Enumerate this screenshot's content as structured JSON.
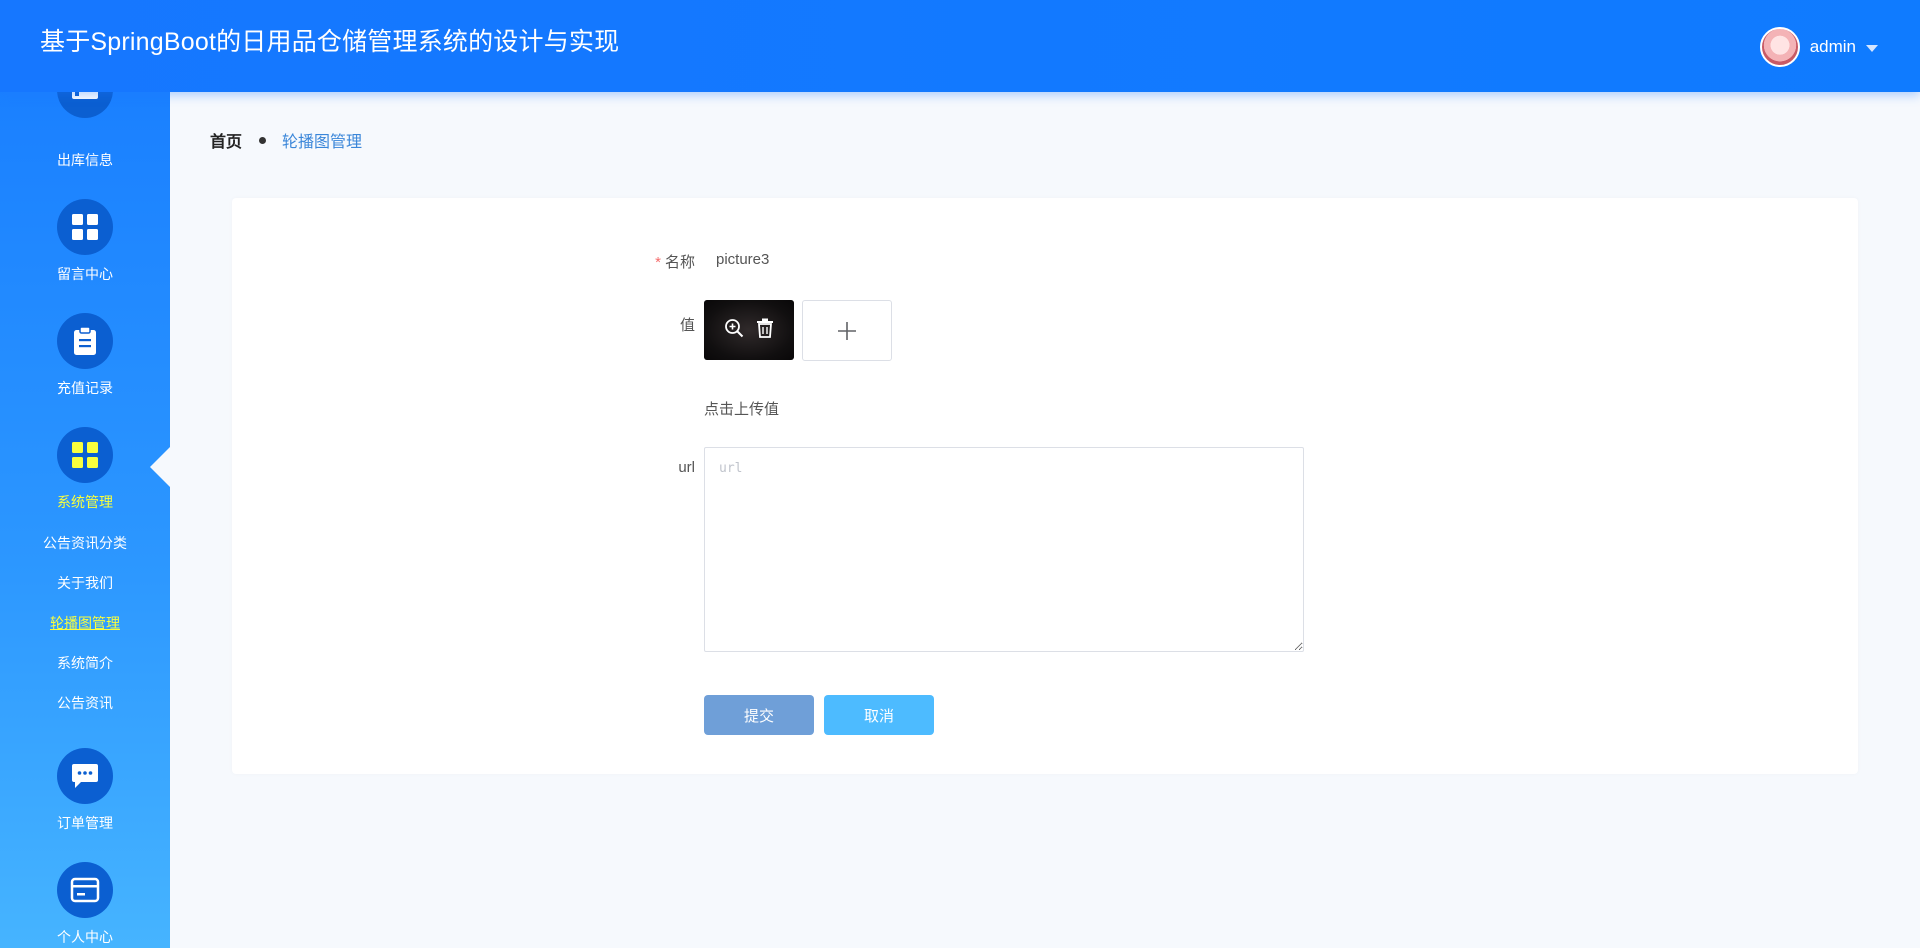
{
  "header": {
    "title": "基于SpringBoot的日用品仓储管理系统的设计与实现",
    "username": "admin"
  },
  "sidebar": {
    "items": [
      {
        "label": "出库信息",
        "icon": "table-icon"
      },
      {
        "label": "留言中心",
        "icon": "grid-icon"
      },
      {
        "label": "充值记录",
        "icon": "clipboard-icon"
      },
      {
        "label": "系统管理",
        "icon": "grid-icon",
        "active": true
      },
      {
        "label": "订单管理",
        "icon": "chat-icon"
      },
      {
        "label": "个人中心",
        "icon": "card-icon"
      }
    ],
    "subitems": [
      {
        "label": "公告资讯分类"
      },
      {
        "label": "关于我们"
      },
      {
        "label": "轮播图管理",
        "active": true
      },
      {
        "label": "系统简介"
      },
      {
        "label": "公告资讯"
      }
    ]
  },
  "breadcrumb": {
    "home": "首页",
    "current": "轮播图管理"
  },
  "form": {
    "name_label": "名称",
    "name_value": "picture3",
    "value_label": "值",
    "upload_hint": "点击上传值",
    "url_label": "url",
    "url_placeholder": "url",
    "submit_label": "提交",
    "cancel_label": "取消"
  },
  "colors": {
    "header": "#1677ff",
    "active_nav": "#f9ff3d",
    "icon_circle": "#0b5fd1",
    "submit": "#6f9fd8",
    "cancel": "#4dbbff",
    "required": "#f56c6c"
  }
}
